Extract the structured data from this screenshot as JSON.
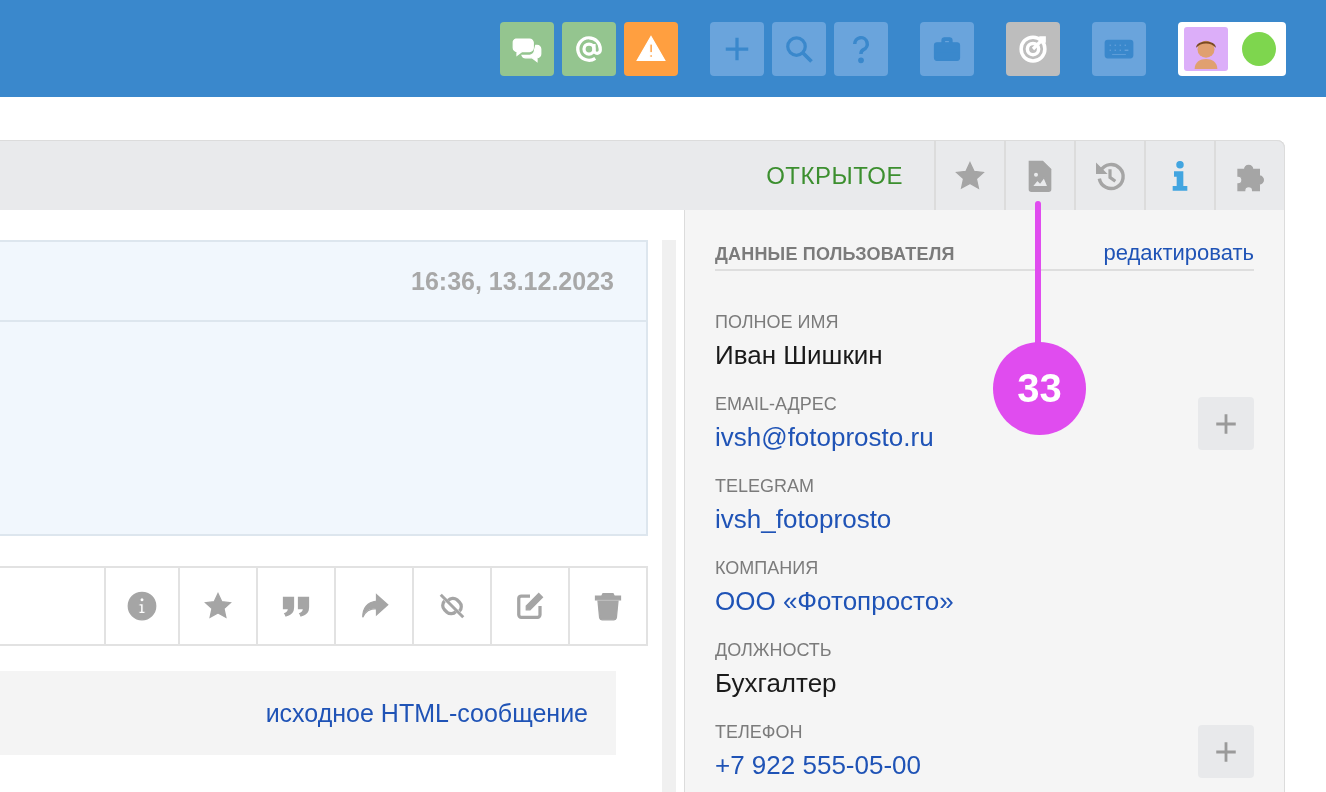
{
  "top_bar": {
    "buttons": [
      {
        "kind": "chats"
      },
      {
        "kind": "mention"
      },
      {
        "kind": "warning"
      },
      {
        "kind": "add"
      },
      {
        "kind": "search"
      },
      {
        "kind": "help"
      },
      {
        "kind": "briefcase"
      },
      {
        "kind": "target"
      },
      {
        "kind": "keyboard"
      }
    ],
    "user": {
      "online": true
    }
  },
  "ticket": {
    "status": "ОТКРЫТОЕ",
    "tabs": [
      {
        "kind": "star",
        "selected": false
      },
      {
        "kind": "image",
        "selected": false
      },
      {
        "kind": "history",
        "selected": false
      },
      {
        "kind": "info",
        "selected": true
      },
      {
        "kind": "plugin",
        "selected": false
      }
    ]
  },
  "message": {
    "time": "16:36, 13.12.2023",
    "actions": [
      {
        "kind": "info"
      },
      {
        "kind": "star"
      },
      {
        "kind": "quote"
      },
      {
        "kind": "forward"
      },
      {
        "kind": "unlink"
      },
      {
        "kind": "edit"
      },
      {
        "kind": "delete"
      }
    ],
    "source_link": "исходное HTML-сообщение"
  },
  "user_data": {
    "title": "ДАННЫЕ ПОЛЬЗОВАТЕЛЯ",
    "edit_link": "редактировать",
    "fields": [
      {
        "label": "ПОЛНОЕ ИМЯ",
        "value": "Иван Шишкин",
        "kind": "text",
        "addable": false
      },
      {
        "label": "EMAIL-АДРЕС",
        "value": "ivsh@fotoprosto.ru",
        "kind": "link",
        "addable": true
      },
      {
        "label": "TELEGRAM",
        "value": "ivsh_fotoprosto",
        "kind": "link",
        "addable": false
      },
      {
        "label": "КОМПАНИЯ",
        "value": "ООО «Фотопросто»",
        "kind": "link",
        "addable": false
      },
      {
        "label": "ДОЛЖНОСТЬ",
        "value": "Бухгалтер",
        "kind": "text",
        "addable": false
      },
      {
        "label": "ТЕЛЕФОН",
        "value": "+7 922 555-05-00",
        "kind": "link",
        "addable": true
      }
    ]
  },
  "callout": {
    "label": "33"
  }
}
